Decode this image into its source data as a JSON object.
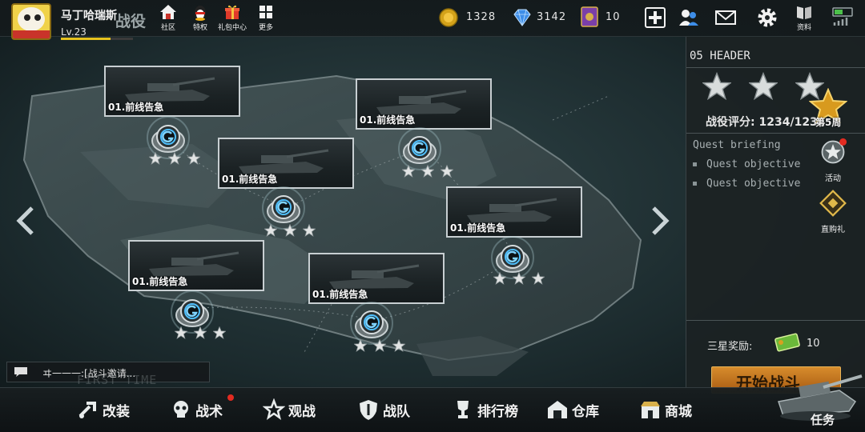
{
  "player": {
    "name": "马丁哈瑞斯",
    "level": "Lv.23",
    "xp_fraction": 0.69
  },
  "page_title": "战役",
  "top_buttons": [
    {
      "label": "社区",
      "icon": "home-icon"
    },
    {
      "label": "特权",
      "icon": "qq-penguin-icon"
    },
    {
      "label": "礼包中心",
      "icon": "gift-icon"
    },
    {
      "label": "更多",
      "icon": "grid-icon"
    }
  ],
  "currencies": [
    {
      "icon": "gold-coin-icon",
      "value": "1328"
    },
    {
      "icon": "diamond-icon",
      "value": "3142"
    },
    {
      "icon": "card-icon",
      "value": "10"
    }
  ],
  "right_icons": [
    {
      "icon": "plus-icon"
    },
    {
      "icon": "friends-icon"
    },
    {
      "icon": "mail-icon"
    },
    {
      "icon": "gear-icon"
    },
    {
      "icon": "book-icon",
      "label": "资料"
    },
    {
      "icon": "signal-battery-icon"
    }
  ],
  "missions": [
    {
      "name": "01.前线告急",
      "stars": 3
    },
    {
      "name": "01.前线告急",
      "stars": 3
    },
    {
      "name": "01.前线告急",
      "stars": 3
    },
    {
      "name": "01.前线告急",
      "stars": 3
    },
    {
      "name": "01.前线告急",
      "stars": 3
    },
    {
      "name": "01.前线告急",
      "stars": 3
    }
  ],
  "panel": {
    "header": "05 HEADER",
    "stars_earned": 3,
    "score_label": "战役评分:",
    "score_value": "1234",
    "score_divider": "/",
    "score_max": "1234",
    "week_badge": "第5周",
    "briefing_title": "Quest briefing",
    "objectives": [
      "Quest objective",
      "Quest objective"
    ],
    "activity_label": "活动",
    "shop_label": "直购礼",
    "reward_label": "三星奖励:",
    "reward_value": "10",
    "start_label": "开始战斗"
  },
  "chat": {
    "text": "ヰ一一一:[战斗邀请..."
  },
  "bottom_nav": [
    {
      "label": "改装",
      "icon": "wrench-icon",
      "notify": false
    },
    {
      "label": "战术",
      "icon": "skull-icon",
      "notify": true
    },
    {
      "label": "观战",
      "icon": "star-badge-icon",
      "notify": false
    },
    {
      "label": "战队",
      "icon": "shield-icon",
      "notify": false
    },
    {
      "label": "排行榜",
      "icon": "trophy-icon",
      "notify": false
    },
    {
      "label": "仓库",
      "icon": "warehouse-icon",
      "notify": false
    },
    {
      "label": "商城",
      "icon": "shop-icon",
      "notify": false
    }
  ],
  "task_label": "任务",
  "faded_caption": "FIRST TIME"
}
